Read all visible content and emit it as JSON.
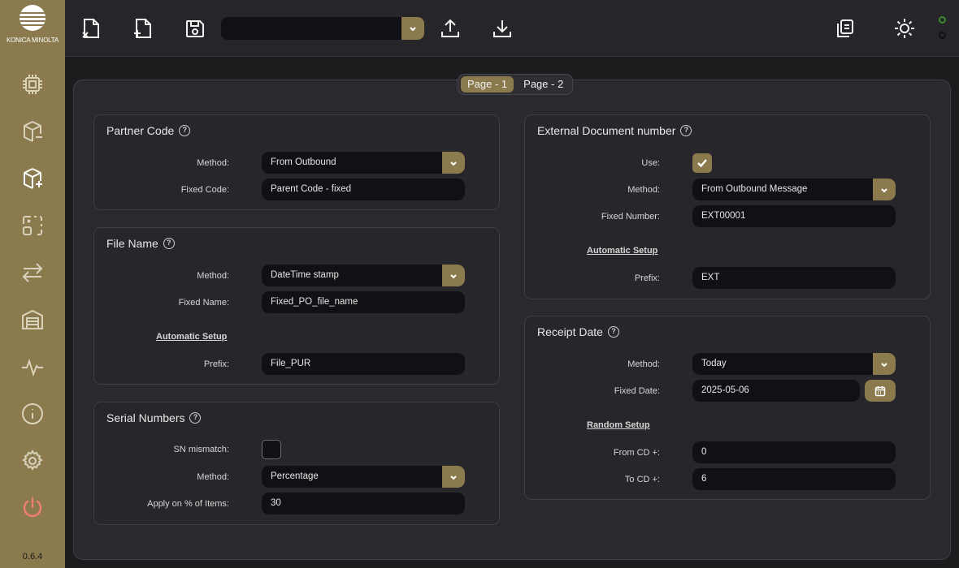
{
  "brand": {
    "logo_text": "KONICA MINOLTA",
    "accent": "#8a7a4d"
  },
  "sidebar": {
    "items": [
      {
        "icon": "chip-icon"
      },
      {
        "icon": "package-remove-icon"
      },
      {
        "icon": "package-add-icon"
      },
      {
        "icon": "scan-frame-icon"
      },
      {
        "icon": "arrows-exchange-icon"
      },
      {
        "icon": "warehouse-icon"
      },
      {
        "icon": "activity-icon"
      },
      {
        "icon": "info-icon"
      },
      {
        "icon": "gear-icon"
      },
      {
        "icon": "power-icon"
      }
    ],
    "version": "0.6.4"
  },
  "toolbar": {
    "select_value": "",
    "status": {
      "top": "#3a8a2a",
      "bottom": "#1a1a1a"
    }
  },
  "pages": {
    "page1": "Page - 1",
    "page2": "Page - 2"
  },
  "partner_code": {
    "title": "Partner Code",
    "method_label": "Method:",
    "method_value": "From Outbound",
    "fixed_label": "Fixed Code:",
    "fixed_value": "Parent Code - fixed"
  },
  "file_name": {
    "title": "File Name",
    "method_label": "Method:",
    "method_value": "DateTime stamp",
    "fixed_label": "Fixed Name:",
    "fixed_value": "Fixed_PO_file_name",
    "auto_link": "Automatic Setup",
    "prefix_label": "Prefix:",
    "prefix_value": "File_PUR"
  },
  "serial_numbers": {
    "title": "Serial Numbers",
    "mismatch_label": "SN mismatch:",
    "mismatch_checked": false,
    "method_label": "Method:",
    "method_value": "Percentage",
    "apply_label": "Apply on % of Items:",
    "apply_value": "30"
  },
  "external_doc": {
    "title": "External Document number",
    "use_label": "Use:",
    "use_checked": true,
    "method_label": "Method:",
    "method_value": "From Outbound Message",
    "fixed_label": "Fixed Number:",
    "fixed_value": "EXT00001",
    "auto_link": "Automatic Setup",
    "prefix_label": "Prefix:",
    "prefix_value": "EXT"
  },
  "receipt_date": {
    "title": "Receipt Date",
    "method_label": "Method:",
    "method_value": "Today",
    "fixed_label": "Fixed Date:",
    "fixed_value": "2025-05-06",
    "random_link": "Random Setup",
    "from_label": "From CD +:",
    "from_value": "0",
    "to_label": "To CD +:",
    "to_value": "6"
  }
}
